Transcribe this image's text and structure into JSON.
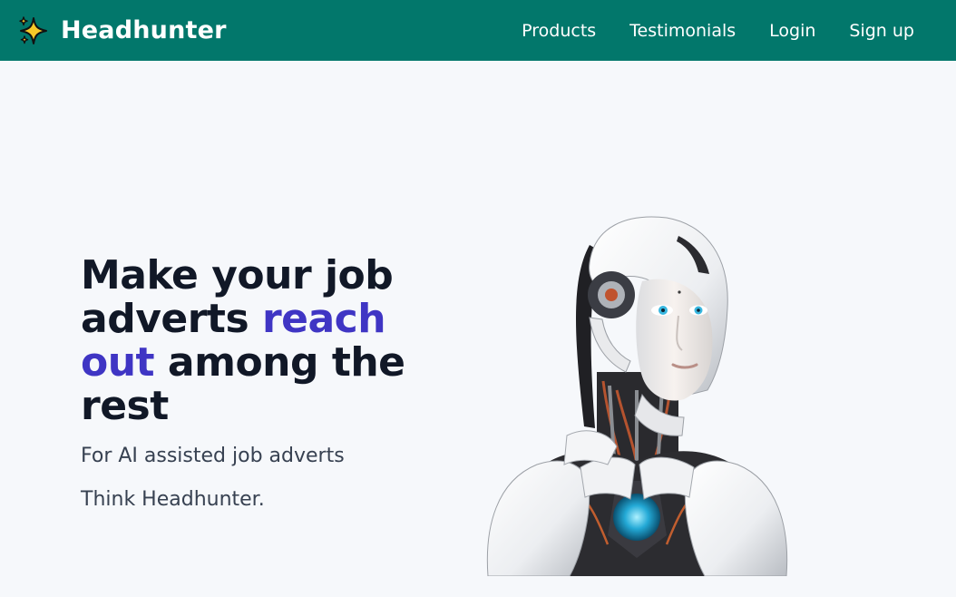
{
  "brand": {
    "name": "Headhunter",
    "icon": "sparkles-icon"
  },
  "nav": {
    "items": [
      {
        "label": "Products"
      },
      {
        "label": "Testimonials"
      },
      {
        "label": "Login"
      },
      {
        "label": "Sign up"
      }
    ]
  },
  "hero": {
    "headline_part1": "Make your job adverts ",
    "headline_accent": "reach out",
    "headline_part2": " among the rest",
    "subtitle": "For AI assisted job adverts",
    "tagline": "Think Headhunter.",
    "image": "humanoid-robot-illustration"
  },
  "colors": {
    "navbar": "#02776b",
    "accent": "#3f35c4",
    "background": "#f6f8fb",
    "headline": "#111827"
  }
}
